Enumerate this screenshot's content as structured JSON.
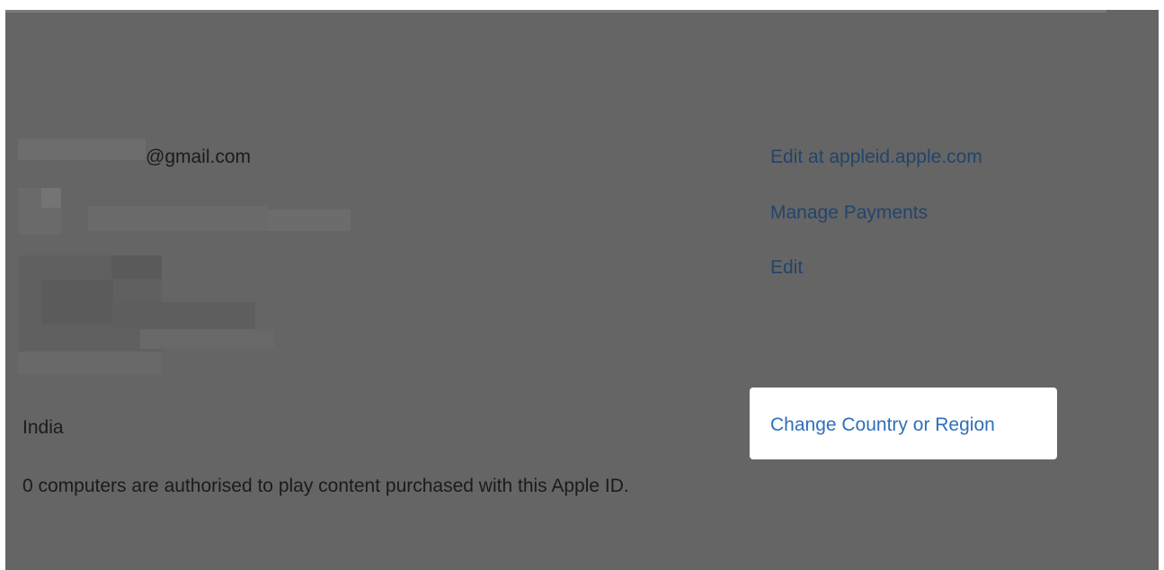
{
  "account": {
    "email_suffix": "@gmail.com",
    "country": "India",
    "authorised_note": "0 computers are authorised to play content purchased with this Apple ID."
  },
  "actions": {
    "edit_apple_id": "Edit at appleid.apple.com",
    "manage_payments": "Manage Payments",
    "edit": "Edit",
    "change_country": "Change Country or Region"
  },
  "colors": {
    "overlay_bg": "#656565",
    "text": "#1b1b1b",
    "dim_link": "#23446b",
    "highlight_link": "#2f6fba",
    "highlight_bg": "#ffffff"
  }
}
